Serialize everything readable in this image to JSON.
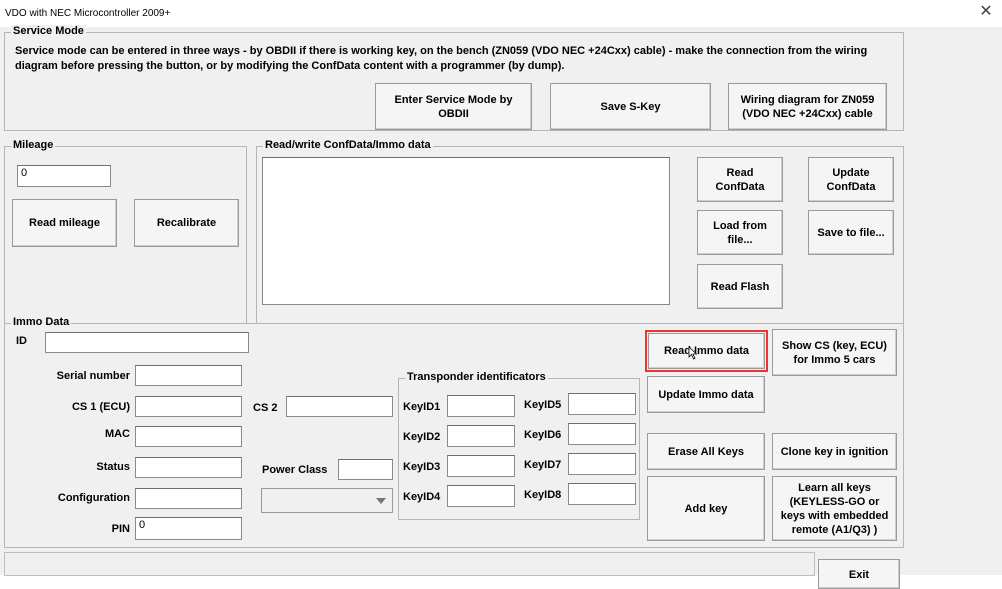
{
  "window": {
    "title": "VDO with NEC Microcontroller 2009+",
    "close_glyph": "✕"
  },
  "service_mode": {
    "legend": "Service Mode",
    "info": "Service mode can be entered in three ways - by OBDII if there is working key, on the bench (ZN059 (VDO NEC +24Cxx) cable) - make the connection from the wiring diagram before pressing the button, or by modifying the ConfData content with a programmer (by dump).",
    "btn_enter": "Enter Service Mode by\nOBDII",
    "btn_save_skey": "Save S-Key",
    "btn_wiring": "Wiring diagram for ZN059\n(VDO NEC +24Cxx) cable"
  },
  "mileage": {
    "legend": "Mileage",
    "value": "0",
    "btn_read": "Read mileage",
    "btn_recalibrate": "Recalibrate"
  },
  "confdata": {
    "legend": "Read/write ConfData/Immo data",
    "text": "",
    "btn_read": "Read\nConfData",
    "btn_update": "Update\nConfData",
    "btn_load": "Load from\nfile...",
    "btn_save": "Save to file...",
    "btn_read_flash": "Read Flash"
  },
  "immo": {
    "legend": "Immo Data",
    "id_label": "ID",
    "id_value": "",
    "serial_label": "Serial number",
    "serial_value": "",
    "cs1_label": "CS 1 (ECU)",
    "cs1_value": "",
    "cs2_label": "CS 2",
    "cs2_value": "",
    "mac_label": "MAC",
    "mac_value": "",
    "status_label": "Status",
    "status_value": "",
    "power_class_label": "Power Class",
    "power_class_value": "",
    "power_class_select": "",
    "configuration_label": "Configuration",
    "configuration_value": "",
    "pin_label": "PIN",
    "pin_value": "0",
    "transponder": {
      "legend": "Transponder identificators",
      "keys": [
        {
          "label": "KeyID1",
          "value": ""
        },
        {
          "label": "KeyID2",
          "value": ""
        },
        {
          "label": "KeyID3",
          "value": ""
        },
        {
          "label": "KeyID4",
          "value": ""
        },
        {
          "label": "KeyID5",
          "value": ""
        },
        {
          "label": "KeyID6",
          "value": ""
        },
        {
          "label": "KeyID7",
          "value": ""
        },
        {
          "label": "KeyID8",
          "value": ""
        }
      ]
    },
    "btn_read_immo": "Read Immo data",
    "btn_show_cs": "Show CS (key, ECU)\nfor Immo 5 cars",
    "btn_update_immo": "Update Immo data",
    "btn_erase_keys": "Erase All Keys",
    "btn_clone_key": "Clone key in ignition",
    "btn_add_key": "Add key",
    "btn_learn_keys": "Learn all keys\n(KEYLESS-GO or\nkeys with embedded\nremote (A1/Q3) )"
  },
  "footer": {
    "btn_exit": "Exit",
    "status_text": ""
  }
}
